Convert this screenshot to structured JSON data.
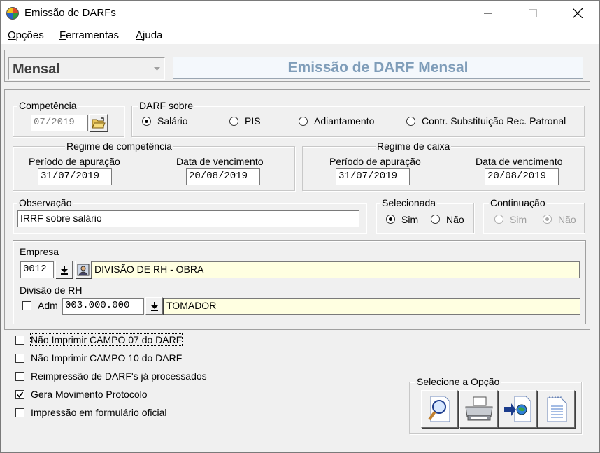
{
  "window": {
    "title": "Emissão de DARFs"
  },
  "menu": [
    {
      "pre": "",
      "u": "O",
      "post": "pções"
    },
    {
      "pre": "",
      "u": "F",
      "post": "erramentas"
    },
    {
      "pre": "",
      "u": "A",
      "post": "juda"
    }
  ],
  "header": {
    "mode_value": "Mensal",
    "banner": "Emissão de DARF Mensal"
  },
  "competencia": {
    "label": "Competência",
    "value": "07/2019"
  },
  "darf_sobre": {
    "label": "DARF sobre",
    "options": [
      "Salário",
      "PIS",
      "Adiantamento",
      "Contr. Substituição Rec. Patronal"
    ],
    "selected": "Salário"
  },
  "regime_competencia": {
    "label": "Regime de competência",
    "periodo_label": "Período de apuração",
    "periodo_value": "31/07/2019",
    "vencimento_label": "Data de vencimento",
    "vencimento_value": "20/08/2019"
  },
  "regime_caixa": {
    "label": "Regime de caixa",
    "periodo_label": "Período de apuração",
    "periodo_value": "31/07/2019",
    "vencimento_label": "Data de vencimento",
    "vencimento_value": "20/08/2019"
  },
  "observacao": {
    "label": "Observação",
    "value": "IRRF sobre salário"
  },
  "selecionada": {
    "label": "Selecionada",
    "sim": "Sim",
    "nao": "Não",
    "selected": "Sim"
  },
  "continuacao": {
    "label": "Continuação",
    "sim": "Sim",
    "nao": "Não",
    "selected": "Não"
  },
  "empresa": {
    "label": "Empresa",
    "code": "0012",
    "name": "DIVISÃO DE RH - OBRA"
  },
  "divisao": {
    "label": "Divisão de RH",
    "adm_label": "Adm",
    "adm_checked": false,
    "code": "003.000.000",
    "name": "TOMADOR"
  },
  "options": [
    {
      "label": "Não Imprimir CAMPO 07 do DARF",
      "checked": false
    },
    {
      "label": "Não Imprimir CAMPO 10 do DARF",
      "checked": false
    },
    {
      "label": "Reimpressão de DARF's já processados",
      "checked": false
    },
    {
      "label": "Gera Movimento Protocolo",
      "checked": true
    },
    {
      "label": "Impressão em formulário oficial",
      "checked": false
    }
  ],
  "actions": {
    "label": "Selecione a Opção",
    "buttons": [
      "magnifier-preview-icon",
      "printer-icon",
      "export-document-icon",
      "document-icon"
    ]
  },
  "colors": {
    "banner_text": "#7f9db9",
    "banner_bg": "#f4f8fc",
    "highlight_field": "#ffffe1"
  }
}
